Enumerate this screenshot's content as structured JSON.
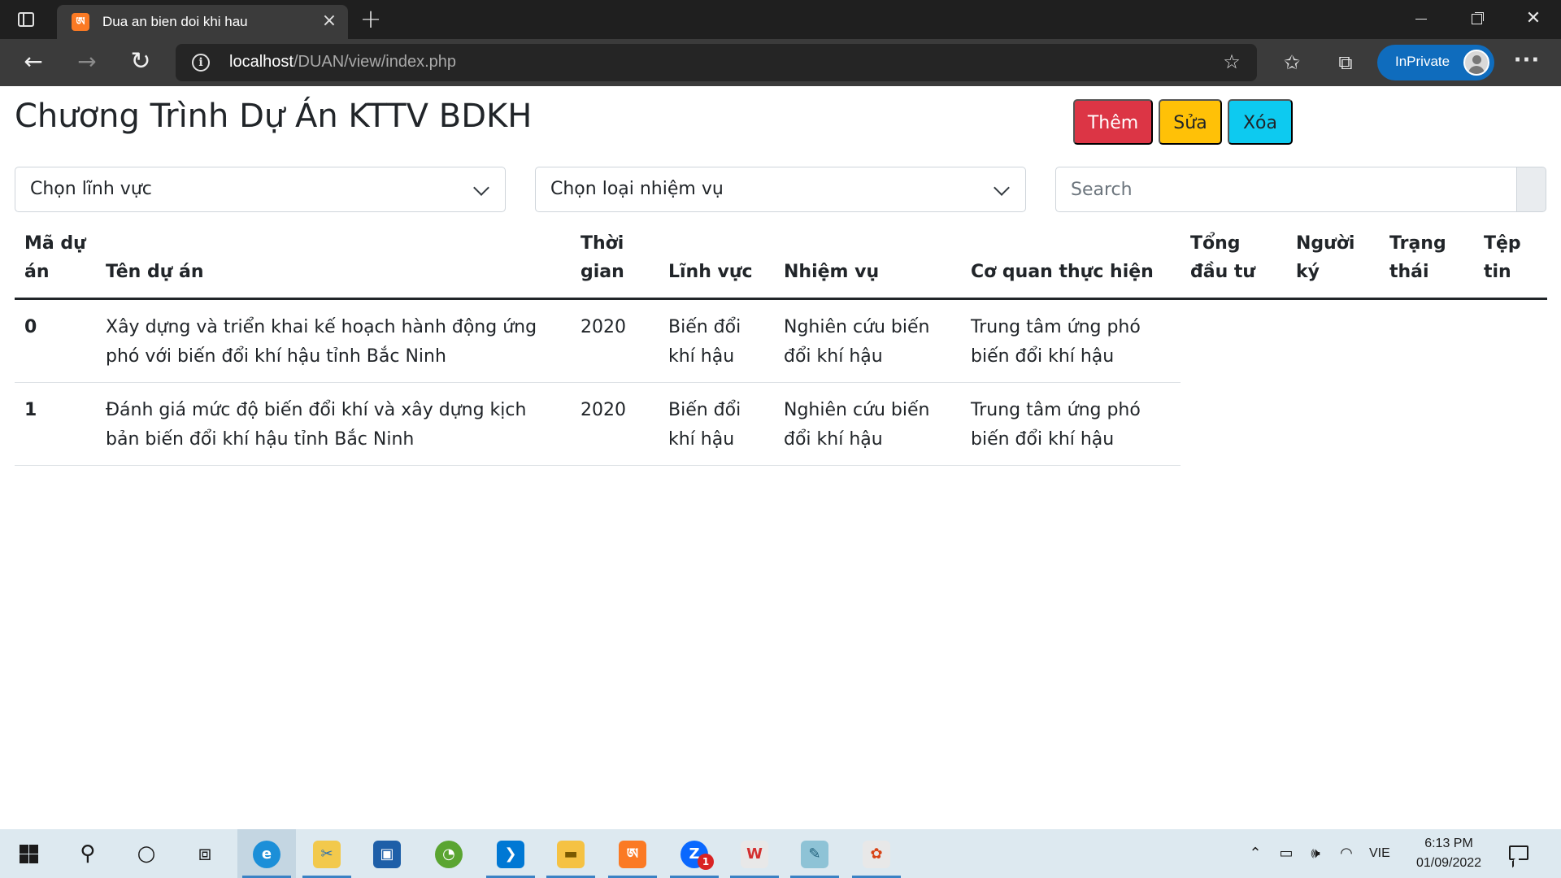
{
  "browser": {
    "tab_title": "Dua an bien doi khi hau",
    "url_host": "localhost",
    "url_path": "/DUAN/view/index.php",
    "inprivate_label": "InPrivate",
    "accent_color": "#0f6cbd"
  },
  "page": {
    "title": "Chương Trình Dự Án KTTV BDKH",
    "buttons": {
      "add": "Thêm",
      "edit": "Sửa",
      "delete": "Xóa"
    },
    "button_colors": {
      "add": "#dc3545",
      "edit": "#ffc107",
      "delete": "#0dcaf0"
    },
    "filters": {
      "field_select": "Chọn lĩnh vực",
      "task_select": "Chọn loại nhiệm vụ",
      "search_placeholder": "Search"
    },
    "table": {
      "headers": {
        "id": "Mã dự án",
        "name": "Tên dự án",
        "time": "Thời gian",
        "field": "Lĩnh vực",
        "task": "Nhiệm vụ",
        "agency": "Cơ quan thực hiện",
        "investment": "Tổng đầu tư",
        "signer": "Người ký",
        "status": "Trạng thái",
        "file": "Tệp tin"
      },
      "rows": [
        {
          "id": "0",
          "name": "Xây dựng và triển khai kế hoạch hành động ứng phó với biến đổi khí hậu tỉnh Bắc Ninh",
          "time": "2020",
          "field": "Biến đổi khí hậu",
          "task": "Nghiên cứu biến đổi khí hậu",
          "agency": "Trung tâm ứng phó biến đổi khí hậu"
        },
        {
          "id": "1",
          "name": "Đánh giá mức độ biến đổi khí và xây dựng kịch bản biến đổi khí hậu tỉnh Bắc Ninh",
          "time": "2020",
          "field": "Biến đổi khí hậu",
          "task": "Nghiên cứu biến đổi khí hậu",
          "agency": "Trung tâm ứng phó biến đổi khí hậu"
        }
      ]
    }
  },
  "taskbar": {
    "apps": [
      "start-icon",
      "search-icon",
      "cortana-icon",
      "task-view-icon",
      "edge-icon",
      "snipping-icon",
      "virtualbox-icon",
      "coccoc-icon",
      "vscode-icon",
      "file-explorer-icon",
      "xampp-icon",
      "zalo-icon",
      "wps-icon",
      "notepad-icon",
      "paint-icon"
    ],
    "zalo_badge": "1",
    "language": "VIE",
    "time": "6:13 PM",
    "date": "01/09/2022"
  }
}
